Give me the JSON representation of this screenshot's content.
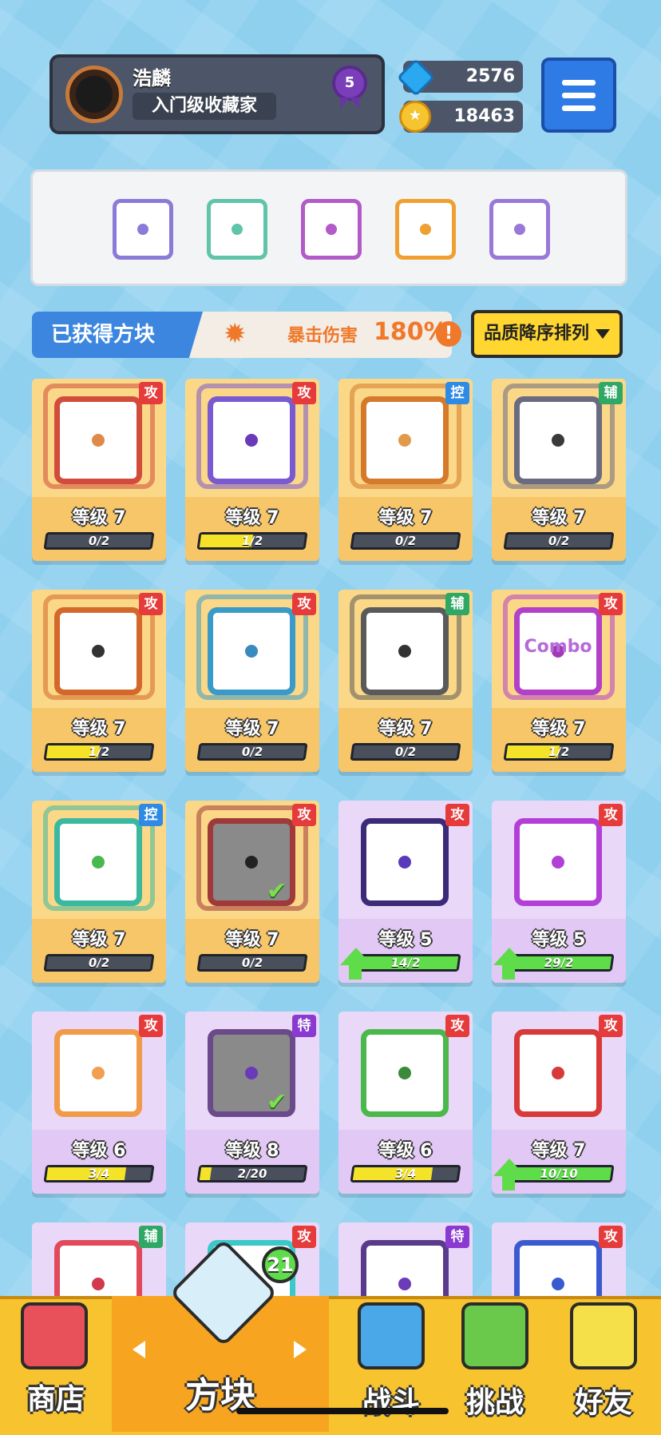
{
  "profile": {
    "name": "浩麟",
    "title": "入门级收藏家",
    "rank": "5",
    "avatar_icon": "apple-logo-icon"
  },
  "currency": {
    "gems": "2576",
    "coins": "18463"
  },
  "equipped": [
    {
      "name": "spike-blade",
      "color": "#8b7ad8"
    },
    {
      "name": "hands",
      "color": "#5fc4a8"
    },
    {
      "name": "pinwheel",
      "color": "#b25ac8"
    },
    {
      "name": "rainbow",
      "color": "#f0a030"
    },
    {
      "name": "shatter",
      "color": "#9a78d8"
    }
  ],
  "info": {
    "owned_label": "已获得方块",
    "crit_label": "暴击伤害",
    "crit_value": "180%",
    "info_icon": "!"
  },
  "sort": {
    "label": "品质降序排列"
  },
  "cards": [
    {
      "tier": "gold",
      "tag": "攻",
      "tag_type": "atk",
      "level": "等级 7",
      "progress": "0/2",
      "fill": 0,
      "frame": "#d24c3c",
      "dot": "#e08a4a",
      "upgrade": false,
      "equipped": false
    },
    {
      "tier": "gold",
      "tag": "攻",
      "tag_type": "atk",
      "level": "等级 7",
      "progress": "1/2",
      "fill": 0.5,
      "frame": "#7a5ad0",
      "dot": "#6a3ab8",
      "upgrade": false,
      "equipped": false
    },
    {
      "tier": "gold",
      "tag": "控",
      "tag_type": "ctl",
      "level": "等级 7",
      "progress": "0/2",
      "fill": 0,
      "frame": "#d47a2a",
      "dot": "#e09a4a",
      "upgrade": false,
      "equipped": false
    },
    {
      "tier": "gold",
      "tag": "辅",
      "tag_type": "sup",
      "level": "等级 7",
      "progress": "0/2",
      "fill": 0,
      "frame": "#6a6a80",
      "dot": "#3a3a3a",
      "upgrade": false,
      "equipped": false
    },
    {
      "tier": "gold",
      "tag": "攻",
      "tag_type": "atk",
      "level": "等级 7",
      "progress": "1/2",
      "fill": 0.5,
      "frame": "#d4682a",
      "dot": "#333",
      "upgrade": false,
      "equipped": false
    },
    {
      "tier": "gold",
      "tag": "攻",
      "tag_type": "atk",
      "level": "等级 7",
      "progress": "0/2",
      "fill": 0,
      "frame": "#3a9ac8",
      "dot": "#3a8ac0",
      "upgrade": false,
      "equipped": false
    },
    {
      "tier": "gold",
      "tag": "辅",
      "tag_type": "sup",
      "level": "等级 7",
      "progress": "0/2",
      "fill": 0,
      "frame": "#5a5a5a",
      "dot": "#333",
      "upgrade": false,
      "equipped": false
    },
    {
      "tier": "gold",
      "tag": "攻",
      "tag_type": "atk",
      "level": "等级 7",
      "progress": "1/2",
      "fill": 0.5,
      "frame": "#b240c8",
      "dot": "#a03ab8",
      "upgrade": false,
      "equipped": false,
      "text": "Combo"
    },
    {
      "tier": "gold",
      "tag": "控",
      "tag_type": "ctl",
      "level": "等级 7",
      "progress": "0/2",
      "fill": 0,
      "frame": "#3ab8a0",
      "dot": "#4ab850",
      "upgrade": false,
      "equipped": false
    },
    {
      "tier": "gold",
      "tag": "攻",
      "tag_type": "atk",
      "level": "等级 7",
      "progress": "0/2",
      "fill": 0,
      "frame": "#a03a3a",
      "dot": "#222",
      "upgrade": false,
      "equipped": true
    },
    {
      "tier": "purple",
      "tag": "攻",
      "tag_type": "atk",
      "level": "等级 5",
      "progress": "14/2",
      "fill": 1,
      "frame": "#3a2a78",
      "dot": "#5a3ab8",
      "upgrade": true,
      "equipped": false
    },
    {
      "tier": "purple",
      "tag": "攻",
      "tag_type": "atk",
      "level": "等级 5",
      "progress": "29/2",
      "fill": 1,
      "frame": "#b240d8",
      "dot": "#b240d8",
      "upgrade": true,
      "equipped": false
    },
    {
      "tier": "purple",
      "tag": "攻",
      "tag_type": "atk",
      "level": "等级 6",
      "progress": "3/4",
      "fill": 0.75,
      "frame": "#f09a4a",
      "dot": "#f0a050",
      "upgrade": false,
      "equipped": false
    },
    {
      "tier": "purple",
      "tag": "特",
      "tag_type": "spc",
      "level": "等级 8",
      "progress": "2/20",
      "fill": 0.1,
      "frame": "#6a4a8a",
      "dot": "#6a3ab8",
      "upgrade": false,
      "equipped": true
    },
    {
      "tier": "purple",
      "tag": "攻",
      "tag_type": "atk",
      "level": "等级 6",
      "progress": "3/4",
      "fill": 0.75,
      "frame": "#4ab84a",
      "dot": "#3a8a3a",
      "upgrade": false,
      "equipped": false
    },
    {
      "tier": "purple",
      "tag": "攻",
      "tag_type": "atk",
      "level": "等级 7",
      "progress": "10/10",
      "fill": 1,
      "frame": "#d83a3a",
      "dot": "#d83a3a",
      "upgrade": true,
      "equipped": false
    },
    {
      "tier": "purple",
      "tag": "辅",
      "tag_type": "sup",
      "frame": "#e04a5a",
      "dot": "#d03a4a",
      "partial": true
    },
    {
      "tier": "purple",
      "tag": "攻",
      "tag_type": "atk",
      "frame": "#3ac8c8",
      "dot": "#3a9ac0",
      "partial": true
    },
    {
      "tier": "purple",
      "tag": "特",
      "tag_type": "spc",
      "frame": "#5a3a8a",
      "dot": "#6a3ab8",
      "partial": true
    },
    {
      "tier": "purple",
      "tag": "攻",
      "tag_type": "atk",
      "frame": "#3a5ad0",
      "dot": "#3a5ad0",
      "partial": true
    }
  ],
  "nav": {
    "shop": "商店",
    "blocks": "方块",
    "battle": "战斗",
    "challenge": "挑战",
    "friends": "好友",
    "blocks_badge": "21"
  }
}
